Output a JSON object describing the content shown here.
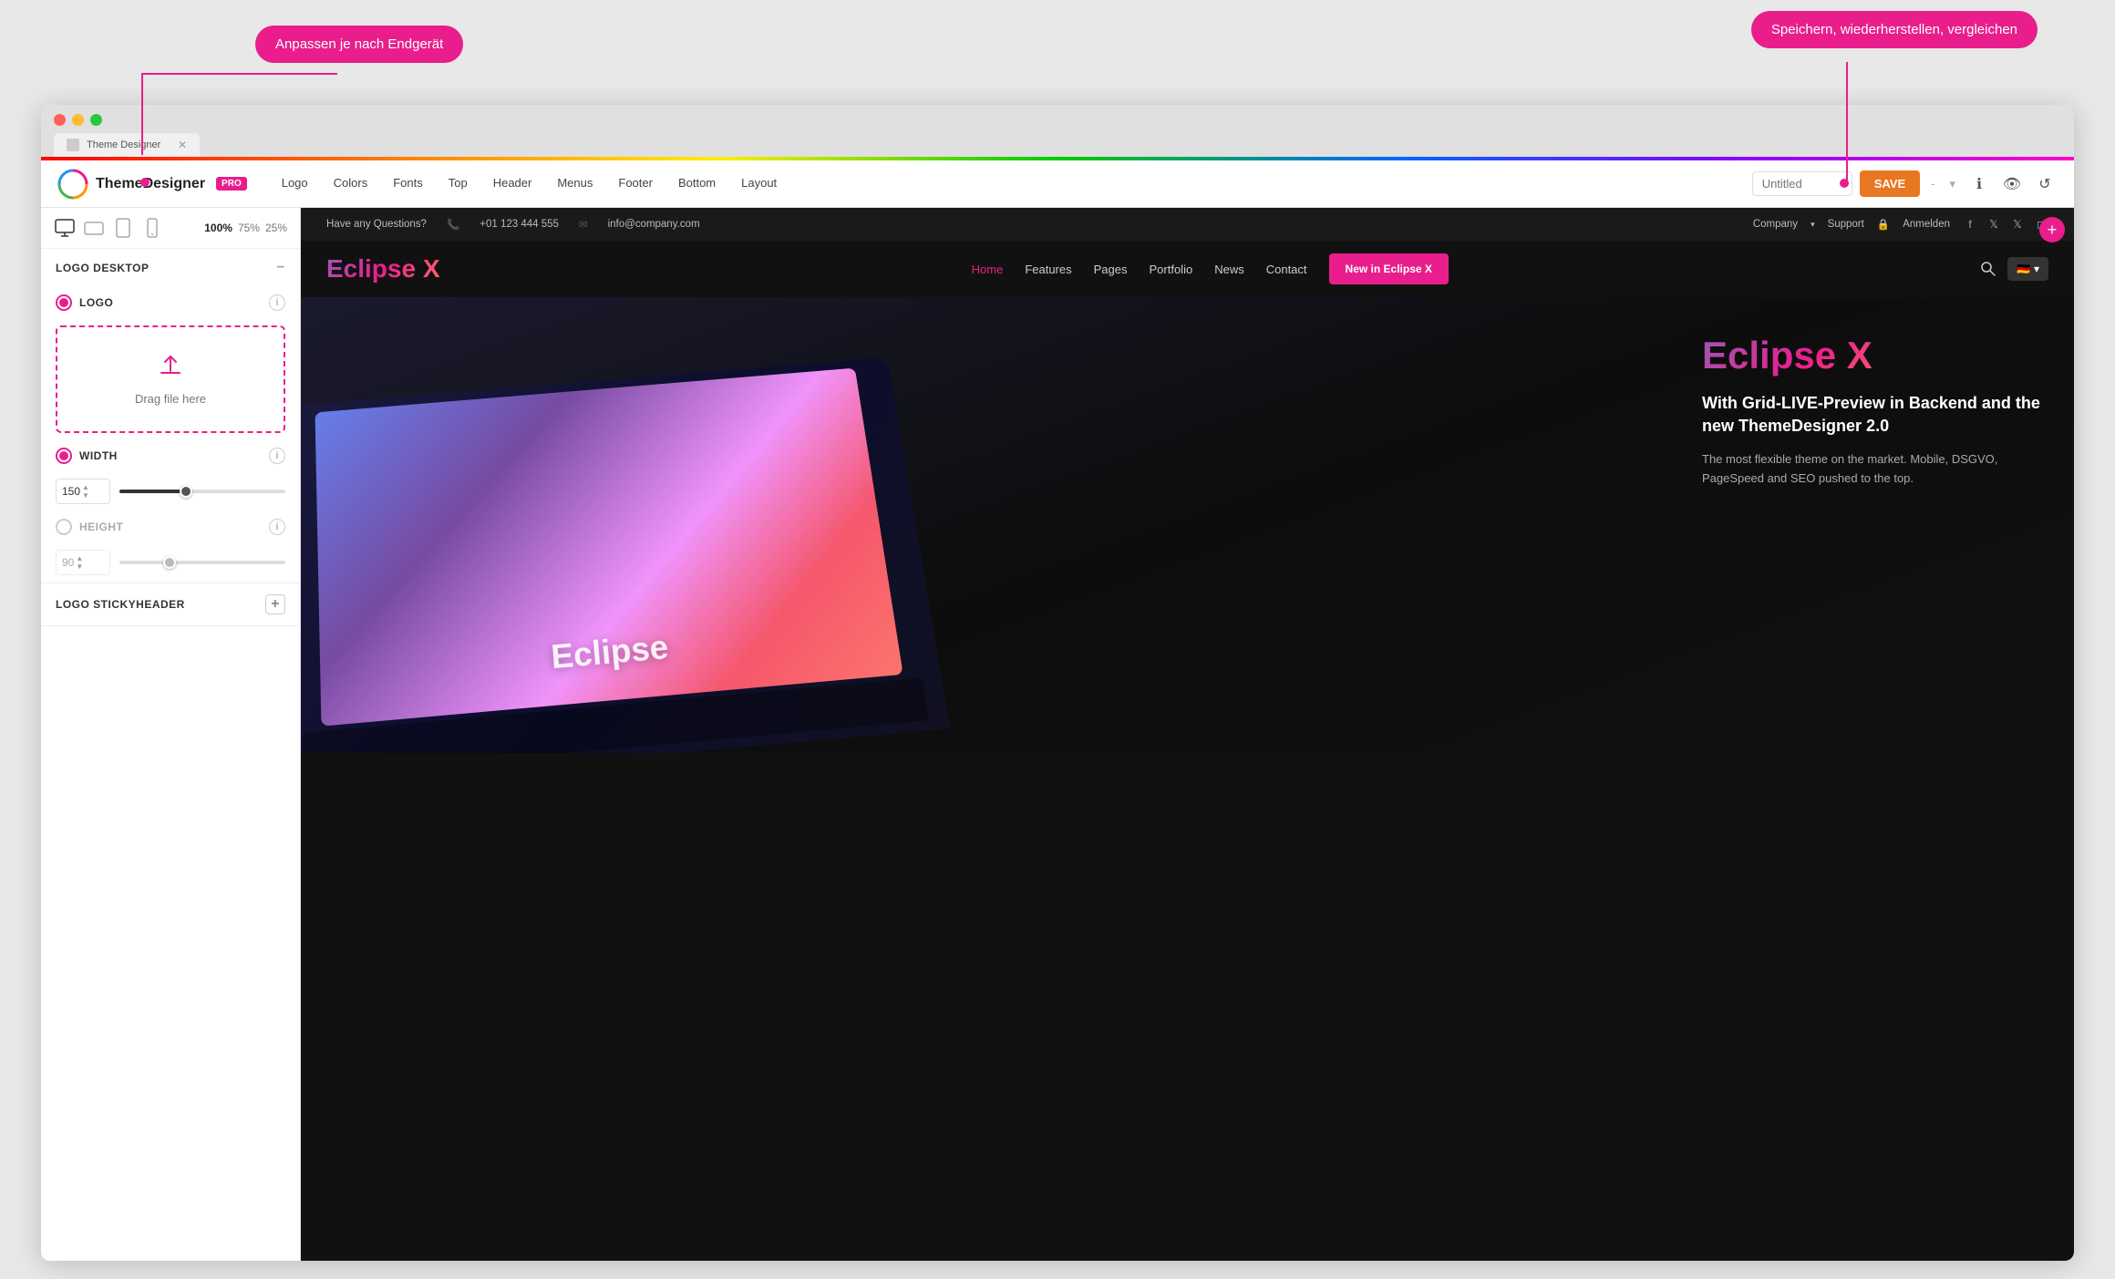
{
  "callouts": {
    "left": "Anpassen je nach Endgerät",
    "right": "Speichern, wiederherstellen, vergleichen"
  },
  "browser": {
    "tab_label": "Theme Designer"
  },
  "app": {
    "logo_text": "ThemeDesigner",
    "pro_badge": "PRO",
    "nav_items": [
      {
        "label": "Logo",
        "id": "logo"
      },
      {
        "label": "Colors",
        "id": "colors"
      },
      {
        "label": "Fonts",
        "id": "fonts"
      },
      {
        "label": "Top",
        "id": "top"
      },
      {
        "label": "Header",
        "id": "header"
      },
      {
        "label": "Menus",
        "id": "menus"
      },
      {
        "label": "Footer",
        "id": "footer"
      },
      {
        "label": "Bottom",
        "id": "bottom"
      },
      {
        "label": "Layout",
        "id": "layout"
      }
    ],
    "nav_input_placeholder": "Untitled",
    "save_btn": "SAVE",
    "dash": "-",
    "zoom_levels": [
      "100%",
      "75%",
      "25%"
    ]
  },
  "sidebar": {
    "logo_desktop_section": "Logo Desktop",
    "logo_toggle_label": "LOGO",
    "drag_label": "Drag file here",
    "width_label": "WIDTH",
    "width_value": "150",
    "height_label": "HEIGHT",
    "height_value": "90",
    "logo_sticky_label": "Logo Stickyheader"
  },
  "site": {
    "topbar": {
      "question": "Have any Questions?",
      "phone": "+01 123 444 555",
      "email": "info@company.com",
      "company_menu": "Company",
      "support": "Support",
      "login": "Anmelden"
    },
    "navbar": {
      "logo": "Eclipse X",
      "links": [
        "Home",
        "Features",
        "Pages",
        "Portfolio",
        "News",
        "Contact"
      ],
      "active_link": "Home",
      "cta_btn": "New in Eclipse X"
    },
    "hero": {
      "title": "Eclipse X",
      "subtitle": "With Grid-LIVE-Preview in Backend and the new ThemeDesigner 2.0",
      "desc": "The most flexible theme on the market. Mobile, DSGVO, PageSpeed and SEO pushed to the top.",
      "device_text": "Eclipse"
    }
  }
}
